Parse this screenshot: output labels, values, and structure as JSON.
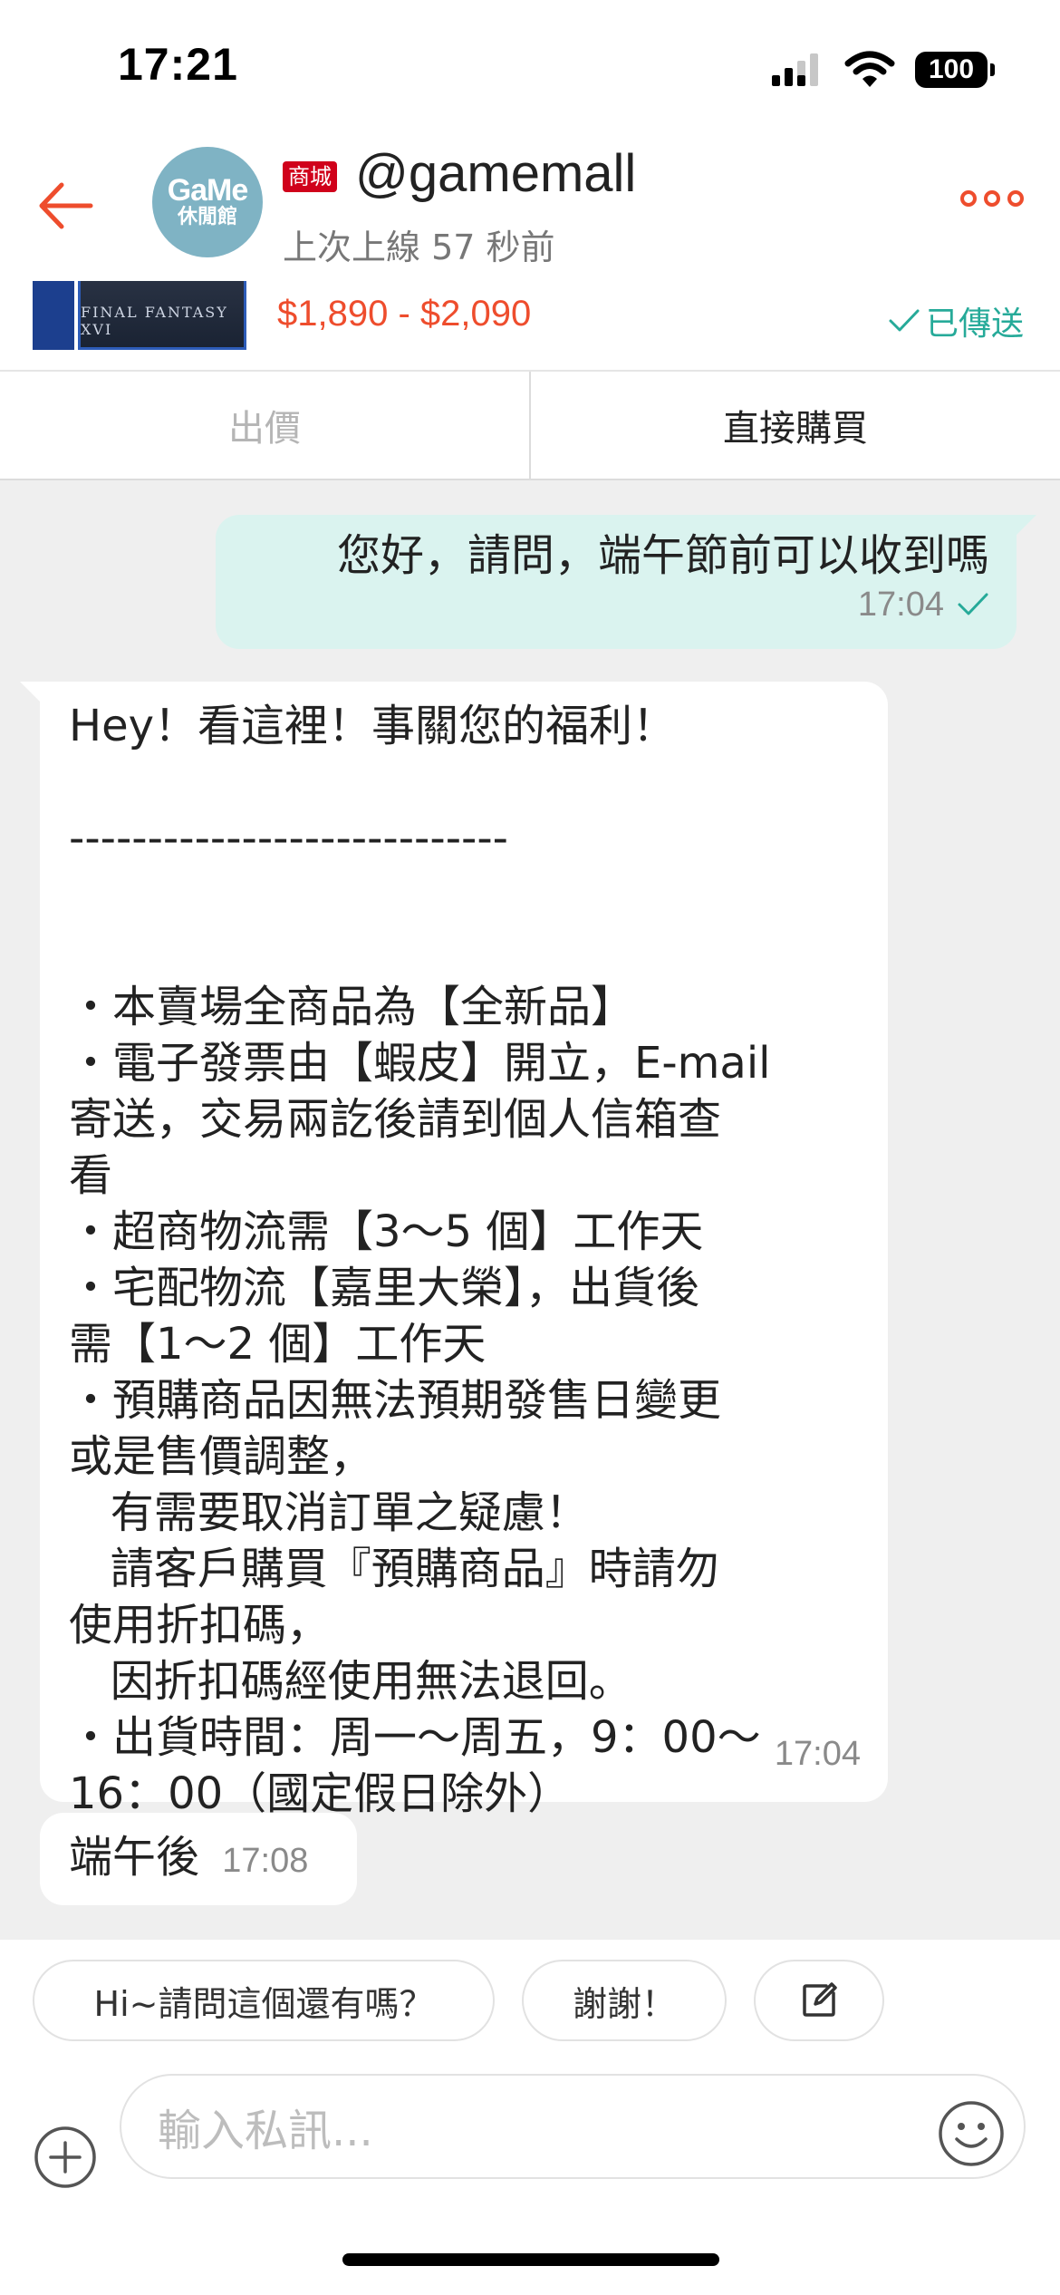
{
  "status_bar": {
    "time": "17:21",
    "battery": "100"
  },
  "header": {
    "avatar_line1": "GaMe",
    "avatar_line2": "休閒館",
    "badge": "商城",
    "shop_name": "@gamemall",
    "last_online": "上次上線 57 秒前"
  },
  "product": {
    "thumb_text": "FINAL FANTASY XVI",
    "price": "$1,890 - $2,090",
    "sent_status": "已傳送"
  },
  "actions": {
    "offer": "出價",
    "buy_now": "直接購買"
  },
  "messages": {
    "outgoing": {
      "text": "您好，請問，端午節前可以收到嗎",
      "time": "17:04"
    },
    "incoming_long": {
      "lines": [
        "Hey！看這裡！事關您的福利！",
        "",
        "----------------------------",
        "",
        "",
        "・本賣場全商品為【全新品】",
        "・電子發票由【蝦皮】開立，E-mail",
        "寄送，交易兩訖後請到個人信箱查",
        "看",
        "・超商物流需【3～5 個】工作天",
        "・宅配物流【嘉里大榮】，出貨後",
        "需【1～2 個】工作天",
        "・預購商品因無法預期發售日變更",
        "或是售價調整，",
        "   有需要取消訂單之疑慮！",
        "   請客戶購買『預購商品』時請勿",
        "使用折扣碼，",
        "   因折扣碼經使用無法退回。",
        "・出貨時間：周一～周五，9：00～",
        "16：00（國定假日除外）"
      ],
      "time": "17:04"
    },
    "incoming_short": {
      "text": "端午後",
      "time": "17:08"
    }
  },
  "quick_replies": [
    "Hi~請問這個還有嗎？",
    "謝謝！"
  ],
  "input": {
    "placeholder": "輸入私訊..."
  },
  "colors": {
    "accent": "#ee4d2d",
    "outgoing_bubble": "#daf3ef",
    "sent_green": "#26aa99"
  }
}
